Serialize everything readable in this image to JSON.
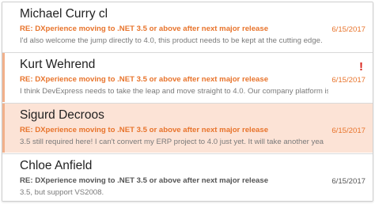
{
  "messages": [
    {
      "sender": "Michael Curry cl",
      "subject": "RE: DXperience moving to .NET 3.5 or above after next major release",
      "preview": "I'd also welcome the jump directly to 4.0, this product needs to be kept at the cutting edge.",
      "date": "6/15/2017",
      "status": "unread",
      "flagged": false,
      "selected": false
    },
    {
      "sender": "Kurt Wehrend",
      "subject": "RE: DXperience moving to .NET 3.5 or above after next major release",
      "preview": "I think DevExpress needs to take the leap and move straight to 4.0. Our company platform is now s",
      "date": "6/15/2017",
      "status": "unread",
      "flagged": true,
      "flag_icon": "!",
      "selected": false
    },
    {
      "sender": "Sigurd Decroos",
      "subject": "RE: DXperience moving to .NET 3.5 or above after next major release",
      "preview": "3.5 still required here! I can't convert my ERP project to 4.0 just yet. It will take another yea",
      "date": "6/15/2017",
      "status": "unread",
      "flagged": false,
      "selected": true
    },
    {
      "sender": "Chloe Anfield",
      "subject": "RE: DXperience moving to .NET 3.5 or above after next major release",
      "preview": "3.5, but support VS2008.",
      "date": "6/15/2017",
      "status": "read",
      "flagged": false,
      "selected": false
    }
  ],
  "colors": {
    "accent_orange": "#e8742c",
    "selected_background": "#fce3d6",
    "row_marker": "#f2b08a",
    "flag_red": "#d9241c",
    "read_text": "#555555"
  }
}
